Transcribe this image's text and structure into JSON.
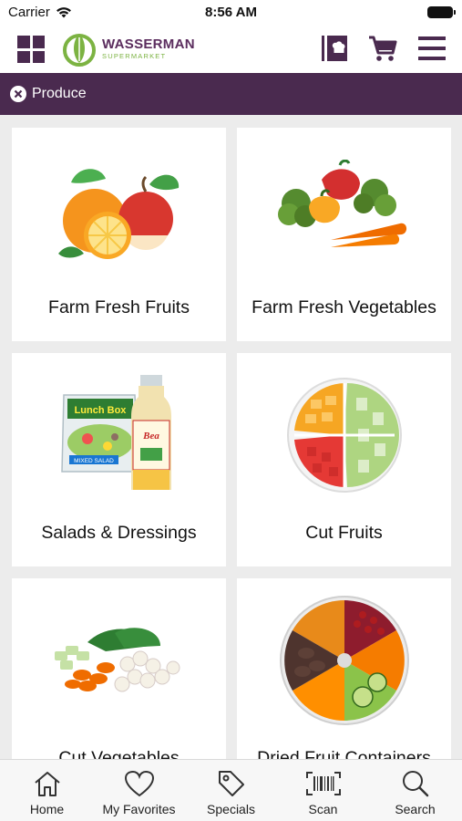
{
  "status_bar": {
    "carrier": "Carrier",
    "time": "8:56 AM"
  },
  "header": {
    "logo_name": "WASSERMAN",
    "logo_sub": "SUPERMARKET",
    "left_icon": "grid-icon",
    "right_icons": [
      "recipe-book-icon",
      "cart-icon",
      "menu-icon"
    ]
  },
  "filter": {
    "label": "Produce",
    "icon": "close-circle-icon"
  },
  "categories": [
    {
      "label": "Farm Fresh Fruits",
      "image": "fruits-photo"
    },
    {
      "label": "Farm Fresh Vegetables",
      "image": "vegetables-photo"
    },
    {
      "label": "Salads & Dressings",
      "image": "salad-dressing-photo"
    },
    {
      "label": "Cut Fruits",
      "image": "cut-fruit-tray-photo"
    },
    {
      "label": "Cut Vegetables",
      "image": "cut-vegetables-photo"
    },
    {
      "label": "Dried Fruit Containers",
      "image": "dried-fruit-tray-photo"
    }
  ],
  "product_labels": {
    "lunch_box": "Lunch Box",
    "salad_tag": "MIXED SALAD",
    "dressing": "Bea"
  },
  "tabs": [
    {
      "label": "Home",
      "icon": "home-icon"
    },
    {
      "label": "My Favorites",
      "icon": "heart-icon"
    },
    {
      "label": "Specials",
      "icon": "tag-icon"
    },
    {
      "label": "Scan",
      "icon": "barcode-icon"
    },
    {
      "label": "Search",
      "icon": "search-icon"
    }
  ],
  "colors": {
    "brand_purple": "#4a2a4f",
    "logo_green": "#7cb342",
    "background": "#ececec"
  }
}
